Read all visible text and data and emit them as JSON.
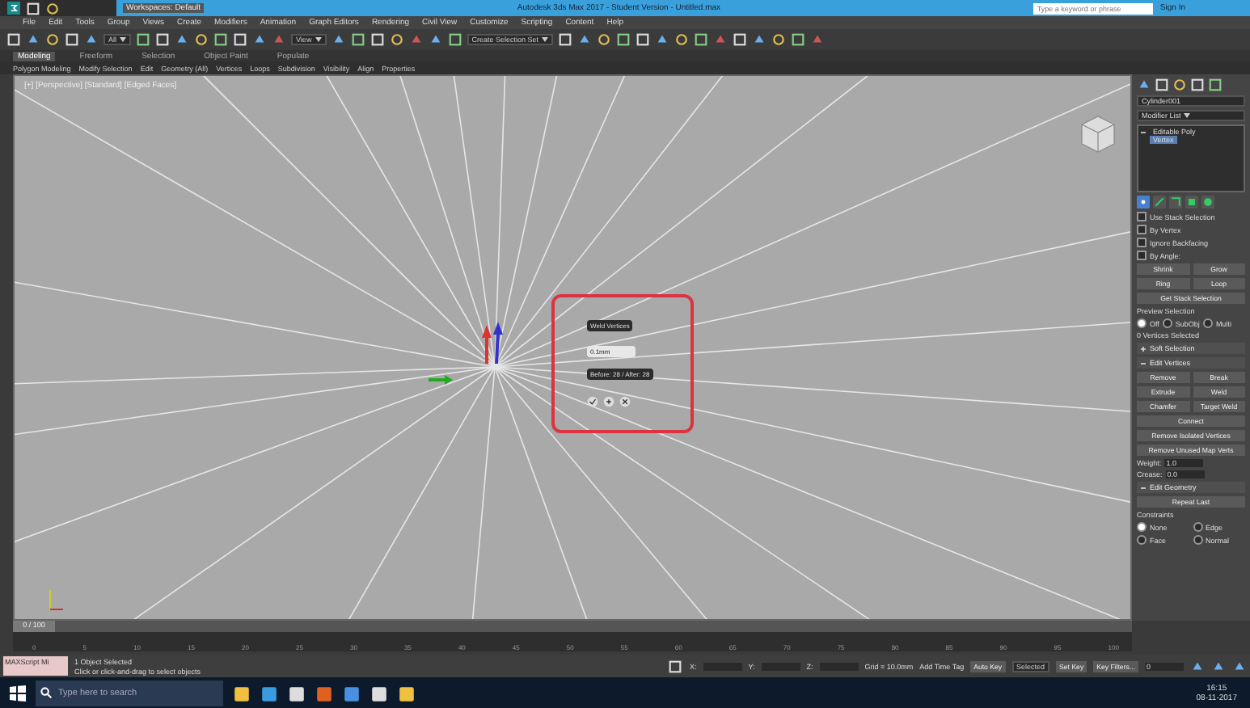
{
  "title_bar": {
    "workspace": "Workspaces: Default",
    "title": "Autodesk 3ds Max 2017 - Student Version - Untitled.max",
    "search": {
      "placeholder": "Type a keyword or phrase"
    },
    "user": "Sign In"
  },
  "menu": [
    "File",
    "Edit",
    "Tools",
    "Group",
    "Views",
    "Create",
    "Modifiers",
    "Animation",
    "Graph Editors",
    "Rendering",
    "Civil View",
    "Customize",
    "Scripting",
    "Content",
    "Help"
  ],
  "toolbar": {
    "filter": "All",
    "view": "View",
    "selection_set": "Create Selection Set"
  },
  "ribbon_tabs": [
    {
      "label": "Modeling",
      "selected": true
    },
    {
      "label": "Freeform",
      "selected": false
    },
    {
      "label": "Selection",
      "selected": false
    },
    {
      "label": "Object Paint",
      "selected": false
    },
    {
      "label": "Populate",
      "selected": false
    }
  ],
  "ribbon_groups": [
    "Polygon Modeling",
    "Modify Selection",
    "Edit",
    "Geometry (All)",
    "Vertices",
    "Loops",
    "Subdivision",
    "Visibility",
    "Align",
    "Properties"
  ],
  "viewport": {
    "label": "[+] [Perspective] [Standard] [Edged Faces]",
    "caddy": {
      "title": "Weld Vertices",
      "value": "0.1mm",
      "info": "Before: 28 / After: 28"
    }
  },
  "command_panel": {
    "object_name": "Cylinder001",
    "modifier_list": "Modifier List",
    "stack": [
      {
        "label": "Editable Poly",
        "expanded": true,
        "selected": false,
        "children": [
          {
            "label": "Vertex",
            "selected": true
          }
        ]
      }
    ],
    "subobject_modes": [
      {
        "kind": "vertex",
        "selected": true
      },
      {
        "kind": "edge",
        "selected": false
      },
      {
        "kind": "border",
        "selected": false
      },
      {
        "kind": "polygon",
        "selected": false
      },
      {
        "kind": "element",
        "selected": false
      }
    ],
    "options": [
      {
        "label": "Use Stack Selection",
        "checked": false
      },
      {
        "label": "By Vertex",
        "checked": false
      },
      {
        "label": "Ignore Backfacing",
        "checked": false
      },
      {
        "label": "By Angle:",
        "checked": false
      }
    ],
    "selection_buttons": [
      "Shrink",
      "Grow",
      "Ring",
      "Loop"
    ],
    "get_stack": "Get Stack Selection",
    "preview_label": "Preview Selection",
    "preview": [
      {
        "label": "Off",
        "selected": true
      },
      {
        "label": "SubObj",
        "selected": false
      },
      {
        "label": "Multi",
        "selected": false
      }
    ],
    "selected_count": "0 Vertices Selected",
    "rollouts": [
      {
        "title": "Soft Selection",
        "expanded": false
      },
      {
        "title": "Edit Vertices",
        "expanded": true
      }
    ],
    "edit_vertices": [
      "Remove",
      "Break",
      "Extrude",
      "Weld",
      "Chamfer",
      "Target Weld",
      "Connect",
      "Remove Isolated Vertices",
      "Remove Unused Map Verts"
    ],
    "weight": {
      "label": "Weight:",
      "value": "1.0"
    },
    "crease": {
      "label": "Crease:",
      "value": "0.0"
    },
    "edit_geometry": {
      "title": "Edit Geometry",
      "repeat": "Repeat Last",
      "constraints": "Constraints",
      "options": [
        {
          "label": "None",
          "selected": true
        },
        {
          "label": "Edge",
          "selected": false
        },
        {
          "label": "Face",
          "selected": false
        },
        {
          "label": "Normal",
          "selected": false
        }
      ]
    }
  },
  "timeline": {
    "slider": "0 / 100",
    "ticks": [
      "0",
      "5",
      "10",
      "15",
      "20",
      "25",
      "30",
      "35",
      "40",
      "45",
      "50",
      "55",
      "60",
      "65",
      "70",
      "75",
      "80",
      "85",
      "90",
      "95",
      "100"
    ]
  },
  "status_bar": {
    "script": "MAXScript Mi",
    "selected": "1 Object Selected",
    "prompt": "Click or click-and-drag to select objects",
    "x": "X:",
    "y": "Y:",
    "z": "Z:",
    "grid": "Grid = 10.0mm",
    "time_tag": "Add Time Tag",
    "auto_key": "Auto Key",
    "key_mode": "Selected",
    "set_key": "Set Key",
    "key_filters": "Key Filters...",
    "frame": "0"
  },
  "taskbar": {
    "search": {
      "placeholder": "Type here to search"
    },
    "time": "16:15",
    "date": "08-11-2017"
  }
}
